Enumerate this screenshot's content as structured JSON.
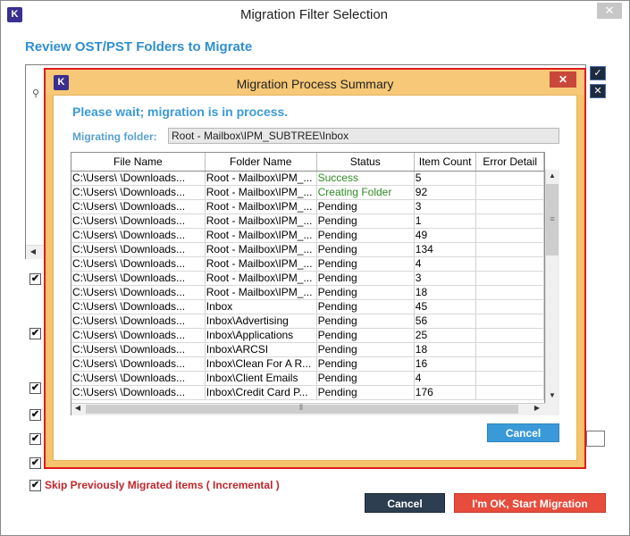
{
  "outer_window": {
    "logo": "K",
    "title": "Migration Filter Selection",
    "close": "✕",
    "heading": "Review OST/PST Folders to Migrate",
    "side_btn_check": "✓",
    "side_btn_x": "✕",
    "skip_label": "Skip Previously Migrated items ( Incremental )",
    "cancel": "Cancel",
    "start": "I'm OK, Start Migration"
  },
  "modal": {
    "logo": "K",
    "title": "Migration Process Summary",
    "close": "✕",
    "wait_text": "Please wait; migration is in process.",
    "migrating_label": "Migrating folder:",
    "migrating_value": "Root - Mailbox\\IPM_SUBTREE\\Inbox",
    "cancel": "Cancel"
  },
  "table": {
    "columns": [
      "File Name",
      "Folder Name",
      "Status",
      "Item Count",
      "Error Detail"
    ],
    "rows": [
      [
        "C:\\Users\\    \\Downloads...",
        "Root - Mailbox\\IPM_...",
        "Success",
        "5",
        ""
      ],
      [
        "C:\\Users\\    \\Downloads...",
        "Root - Mailbox\\IPM_...",
        "Creating Folder",
        "92",
        ""
      ],
      [
        "C:\\Users\\    \\Downloads...",
        "Root - Mailbox\\IPM_...",
        "Pending",
        "3",
        ""
      ],
      [
        "C:\\Users\\    \\Downloads...",
        "Root - Mailbox\\IPM_...",
        "Pending",
        "1",
        ""
      ],
      [
        "C:\\Users\\    \\Downloads...",
        "Root - Mailbox\\IPM_...",
        "Pending",
        "49",
        ""
      ],
      [
        "C:\\Users\\    \\Downloads...",
        "Root - Mailbox\\IPM_...",
        "Pending",
        "134",
        ""
      ],
      [
        "C:\\Users\\    \\Downloads...",
        "Root - Mailbox\\IPM_...",
        "Pending",
        "4",
        ""
      ],
      [
        "C:\\Users\\    \\Downloads...",
        "Root - Mailbox\\IPM_...",
        "Pending",
        "3",
        ""
      ],
      [
        "C:\\Users\\    \\Downloads...",
        "Root - Mailbox\\IPM_...",
        "Pending",
        "18",
        ""
      ],
      [
        "C:\\Users\\    \\Downloads...",
        "Inbox",
        "Pending",
        "45",
        ""
      ],
      [
        "C:\\Users\\    \\Downloads...",
        "Inbox\\Advertising",
        "Pending",
        "56",
        ""
      ],
      [
        "C:\\Users\\    \\Downloads...",
        "Inbox\\Applications",
        "Pending",
        "25",
        ""
      ],
      [
        "C:\\Users\\    \\Downloads...",
        "Inbox\\ARCSI",
        "Pending",
        "18",
        ""
      ],
      [
        "C:\\Users\\    \\Downloads...",
        "Inbox\\Clean For A R...",
        "Pending",
        "16",
        ""
      ],
      [
        "C:\\Users\\    \\Downloads...",
        "Inbox\\Client Emails",
        "Pending",
        "4",
        ""
      ],
      [
        "C:\\Users\\    \\Downloads...",
        "Inbox\\Credit Card P...",
        "Pending",
        "176",
        ""
      ]
    ]
  },
  "colors": {
    "success": "#2e8b22",
    "accent_blue": "#3a9ad9",
    "modal_frame": "#f5c36b",
    "alert_red": "#e74c3c"
  },
  "icons": {
    "tree_expander": "expand-node-icon",
    "checkbox": "checkmark-icon",
    "scroll_up": "arrow-up-icon",
    "scroll_down": "arrow-down-icon"
  }
}
